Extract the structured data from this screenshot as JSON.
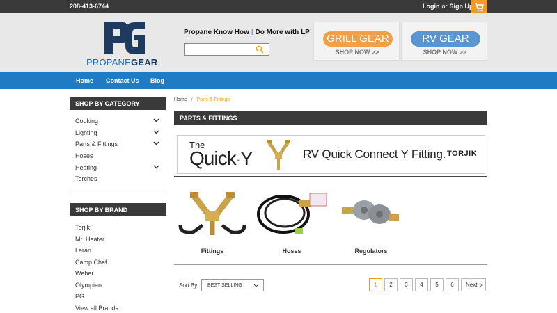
{
  "topbar": {
    "phone": "208-413-6744",
    "login": "Login",
    "or": "or",
    "signup": "Sign Up"
  },
  "header": {
    "logo_part1": "PROPANE",
    "logo_part2": "GEAR",
    "knowhow": "Propane Know How",
    "domore": "Do More with LP",
    "search_placeholder": "",
    "promos": [
      {
        "title": "GRILL GEAR",
        "shop": "SHOP NOW >>",
        "color": "#f0a04a"
      },
      {
        "title": "RV GEAR",
        "shop": "SHOP NOW >>",
        "color": "#5b95cf"
      }
    ]
  },
  "nav": {
    "items": [
      "Home",
      "Contact Us",
      "Blog"
    ]
  },
  "sidebar": {
    "category_title": "SHOP BY CATEGORY",
    "categories": [
      "Cooking",
      "Lighting",
      "Parts & Fittings",
      "Hoses",
      "Heating",
      "Torches"
    ],
    "brand_title": "SHOP BY BRAND",
    "brands": [
      "Torjik",
      "Mr. Heater",
      "Leran",
      "Camp Chef",
      "Weber",
      "Olympian",
      "PG",
      "View all Brands"
    ]
  },
  "breadcrumb": {
    "home": "Home",
    "current": "Parts & Fittings"
  },
  "main": {
    "title": "PARTS & FITTINGS",
    "banner": {
      "the": "The",
      "quick": "Quick",
      "y": "Y",
      "text": "RV Quick Connect Y Fitting.",
      "brand": "TORJIK"
    },
    "subcategories": [
      "Fittings",
      "Hoses",
      "Regulators"
    ],
    "sort_label": "Sort By:",
    "sort_value": "BEST SELLING",
    "pages": [
      "1",
      "2",
      "3",
      "4",
      "5",
      "6"
    ],
    "next": "Next"
  },
  "colors": {
    "accent": "#f39a2d",
    "nav": "#1f7bc3",
    "dark": "#3a3a3a"
  }
}
